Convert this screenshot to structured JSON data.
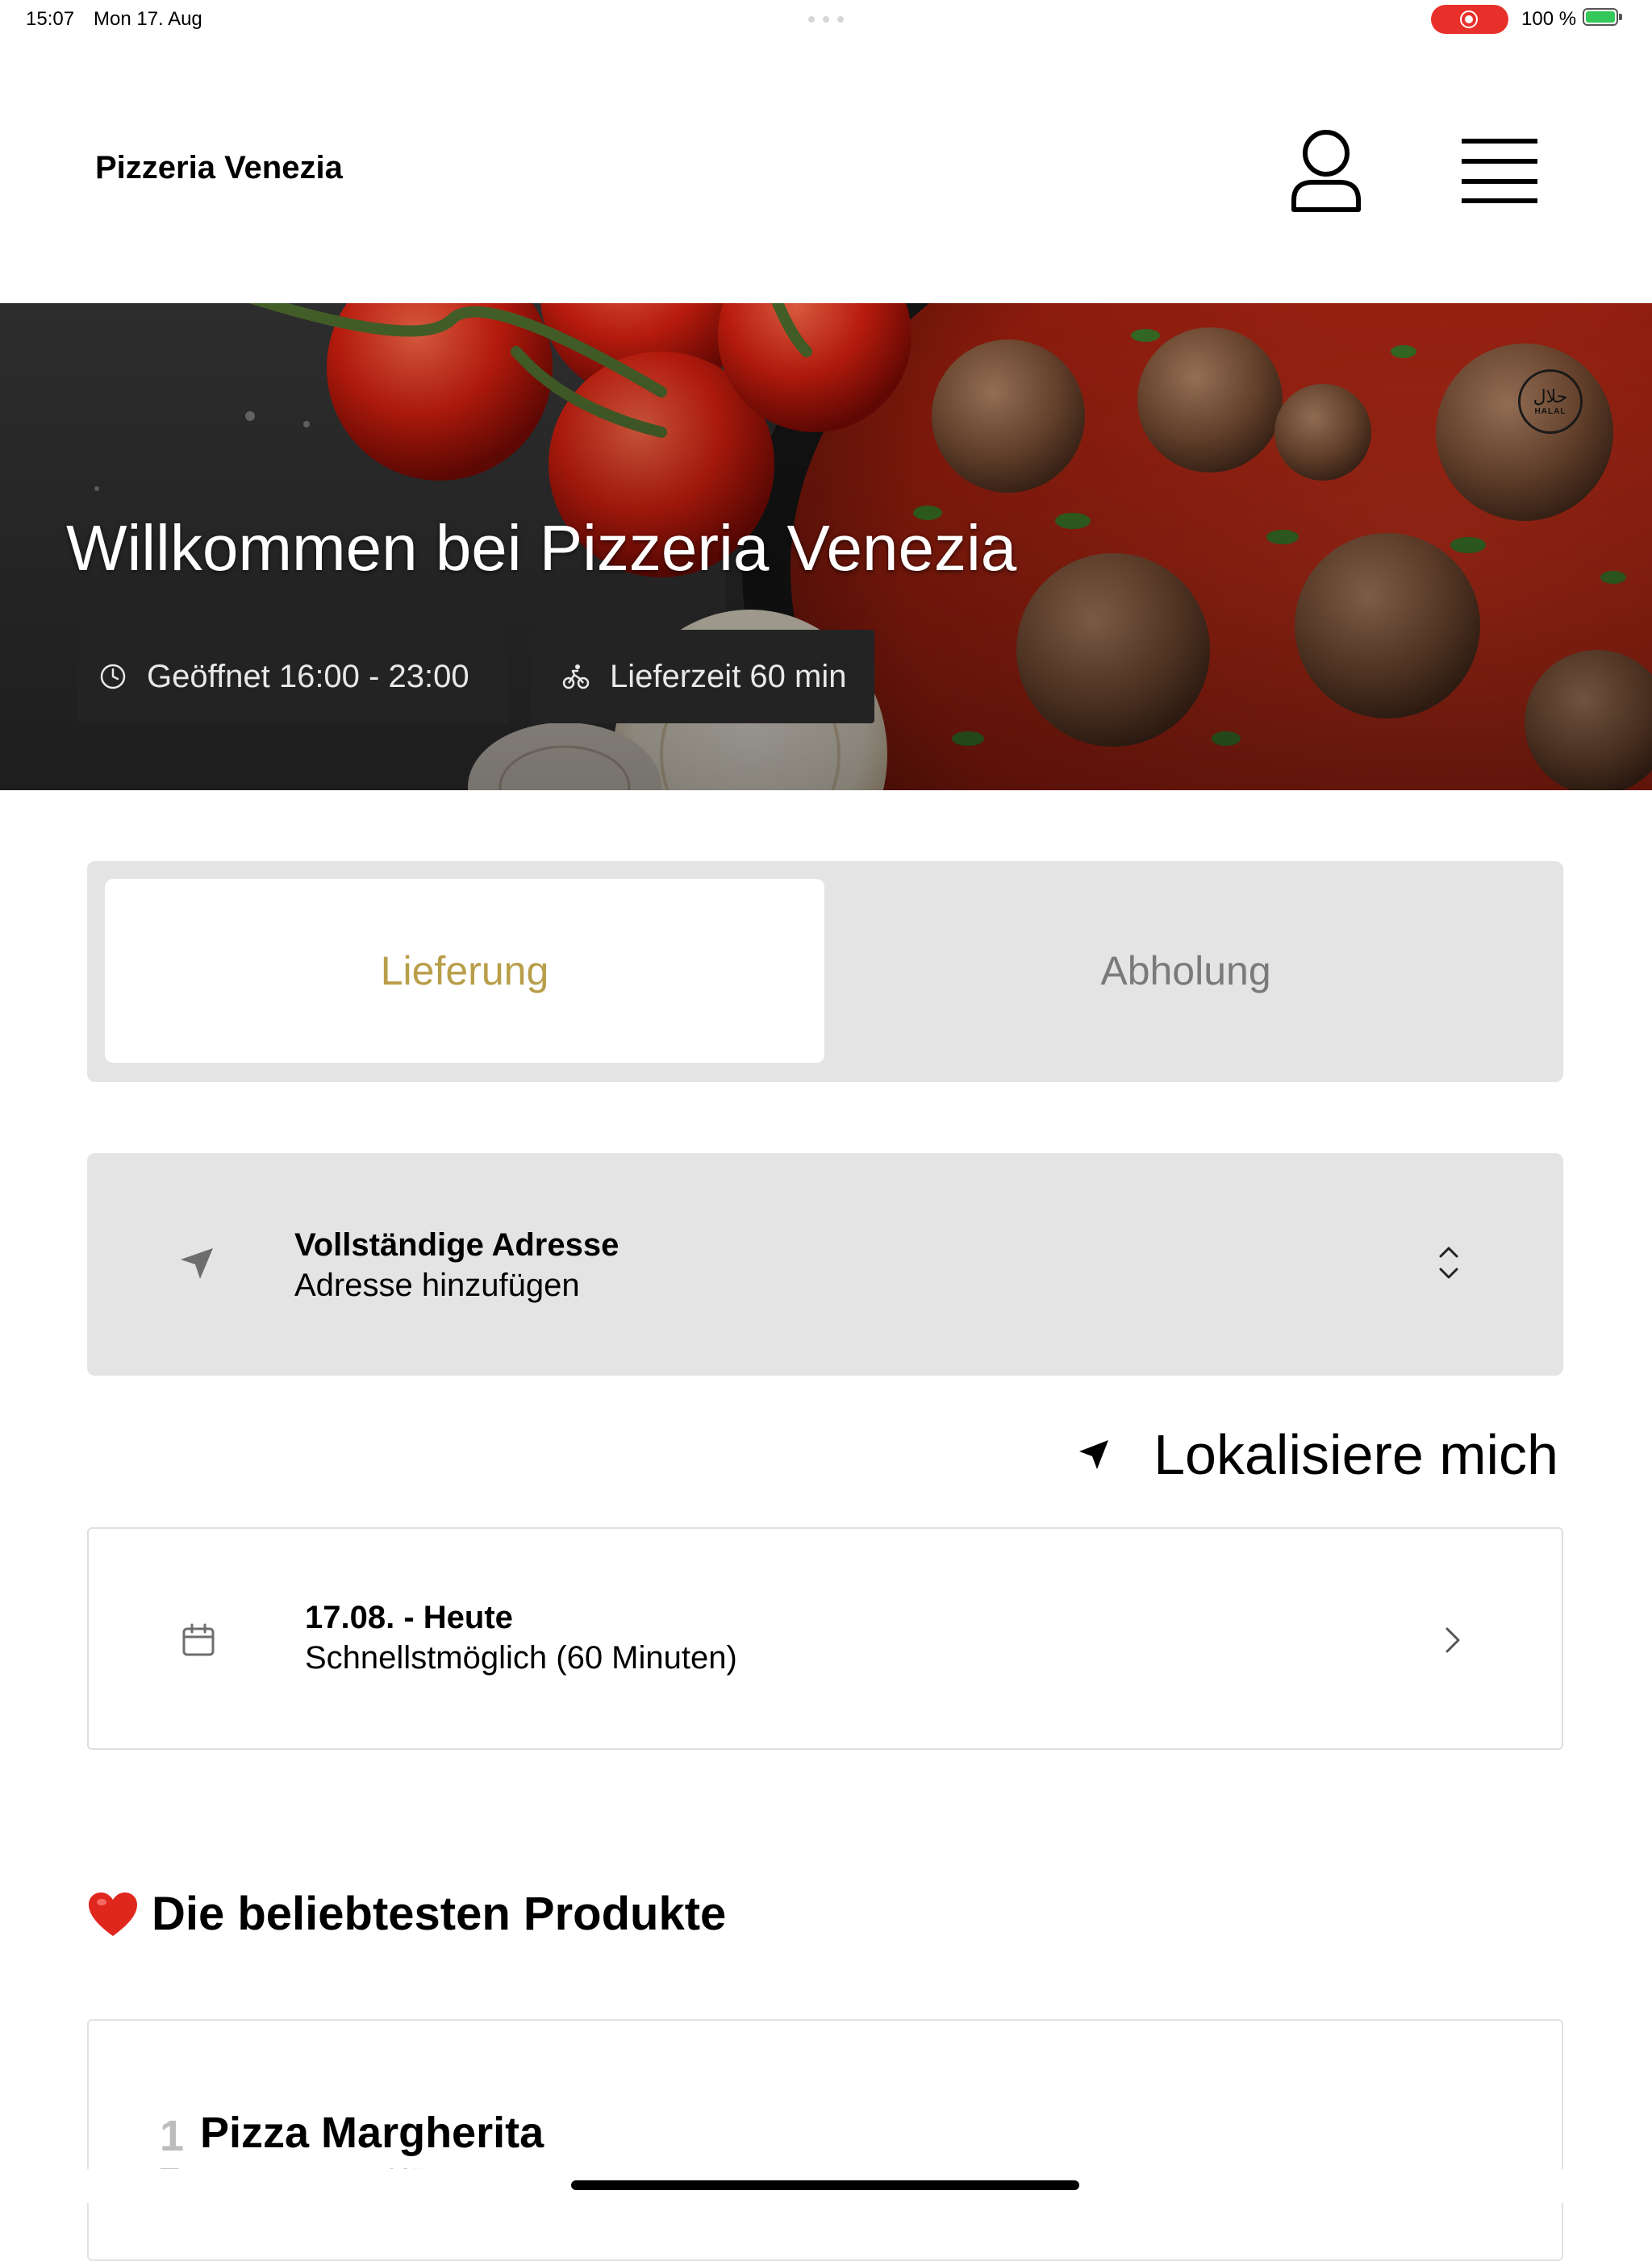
{
  "status_bar": {
    "time": "15:07",
    "date": "Mon 17. Aug",
    "battery_text": "100 %",
    "recording_color": "#e8302a",
    "battery_color": "#34c759"
  },
  "header": {
    "brand": "Pizzeria Venezia",
    "user_icon": "user-icon",
    "menu_icon": "hamburger-menu-icon"
  },
  "hero": {
    "title": "Willkommen bei Pizzeria Venezia",
    "opening": "Geöffnet 16:00 - 23:00",
    "delivery_time": "Lieferzeit 60 min",
    "halal_arabic": "حلال",
    "halal_text": "HALAL"
  },
  "mode_toggle": {
    "delivery": "Lieferung",
    "pickup": "Abholung",
    "selected": "Lieferung",
    "accent_color": "#b99e4a"
  },
  "address": {
    "title": "Vollständige Adresse",
    "subtitle": "Adresse hinzufügen"
  },
  "locate": {
    "label": "Lokalisiere mich"
  },
  "date_picker": {
    "title": "17.08. - Heute",
    "subtitle": "Schnellstmöglich (60 Minuten)"
  },
  "popular": {
    "heading": "Die beliebtesten Produkte",
    "products": [
      {
        "rank": "1",
        "name": "Pizza Margherita",
        "description": "Tomatensauce, Käse"
      }
    ]
  }
}
